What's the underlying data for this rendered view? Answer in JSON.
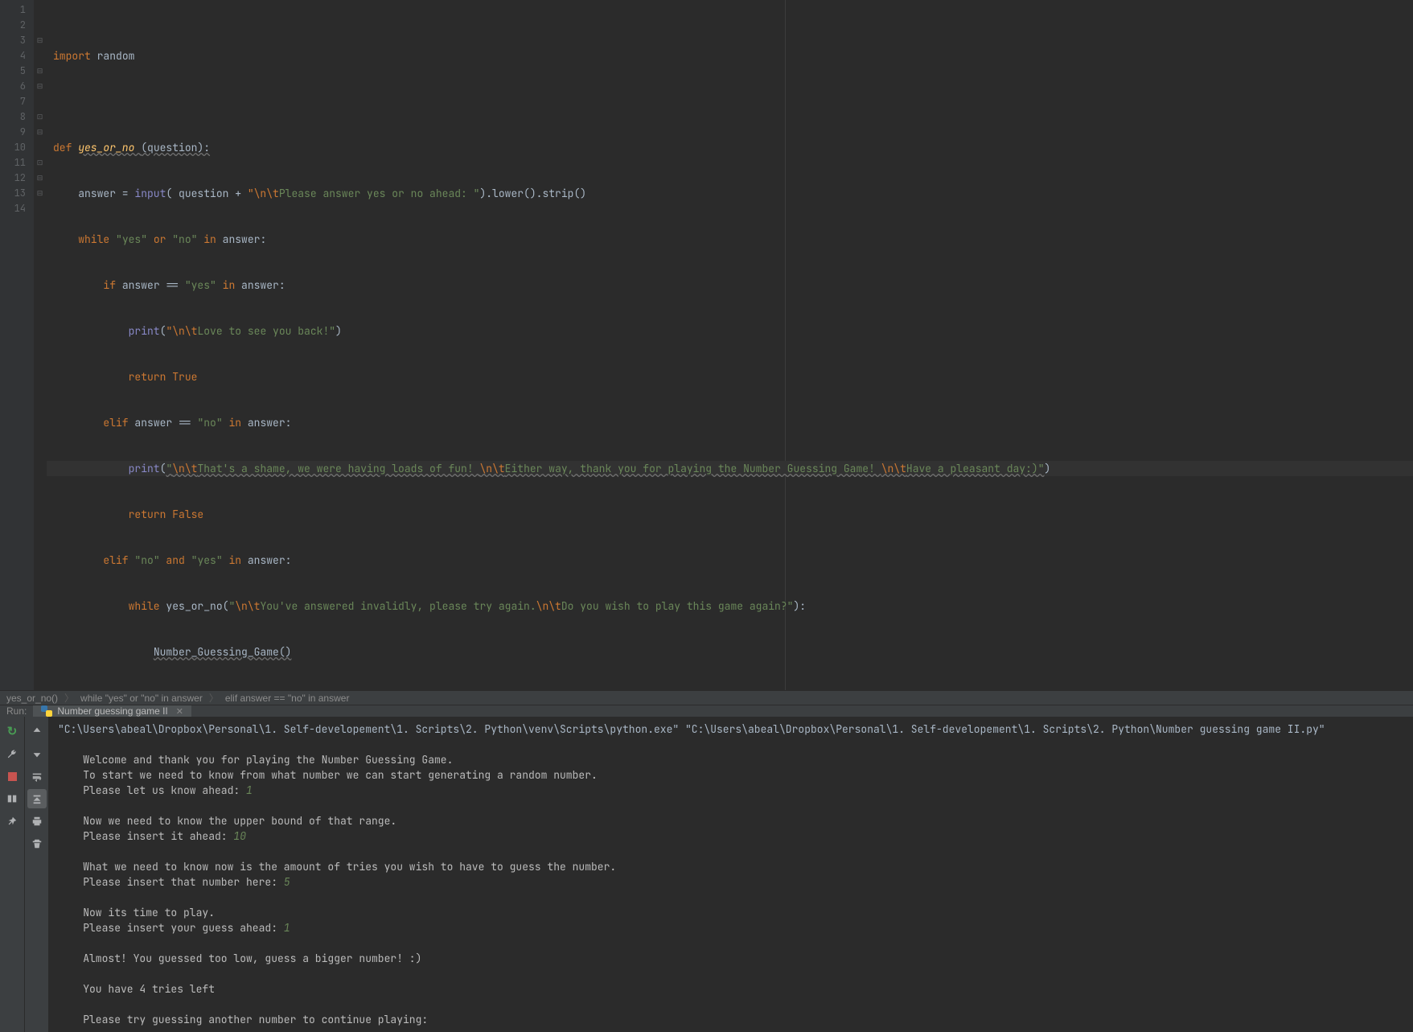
{
  "editor": {
    "lines": [
      "1",
      "2",
      "3",
      "4",
      "5",
      "6",
      "7",
      "8",
      "9",
      "10",
      "11",
      "12",
      "13",
      "14"
    ],
    "highlighted_line": 10,
    "code": {
      "l1": {
        "kw": "import",
        "mod": " random"
      },
      "l3": {
        "kw": "def ",
        "fn": "yes_or_no ",
        "params": "(question):"
      },
      "l4": {
        "indent": "    ",
        "lhs": "answer = ",
        "builtin": "input",
        "open": "( question + ",
        "str1_esc": "\"\\n\\t",
        "str1_body": "Please answer yes or no ahead: \"",
        "tail": ").lower().strip()"
      },
      "l5": {
        "indent": "    ",
        "kw": "while ",
        "s1": "\"yes\"",
        "or": " or ",
        "s2": "\"no\"",
        "in": " in ",
        "rest": "answer:"
      },
      "l6": {
        "indent": "        ",
        "kw": "if ",
        "lhs": "answer == ",
        "s": "\"yes\"",
        "in": " in ",
        "rest": "answer:"
      },
      "l7": {
        "indent": "            ",
        "print": "print",
        "open": "(",
        "esc": "\"\\n\\t",
        "body": "Love to see you back!\"",
        "close": ")"
      },
      "l8": {
        "indent": "            ",
        "kw": "return ",
        "val": "True"
      },
      "l9": {
        "indent": "        ",
        "kw": "elif ",
        "lhs": "answer == ",
        "s": "\"no\"",
        "in": " in ",
        "rest": "answer:"
      },
      "l10": {
        "indent": "            ",
        "print": "print",
        "open": "(",
        "s_open": "\"",
        "e1": "\\n\\t",
        "t1": "That's a shame, we were having loads of fun! ",
        "e2": "\\n\\t",
        "t2": "Either way, thank you for playing the Number Guessing Game! ",
        "e3": "\\n\\t",
        "t3": "Have a pleasant day:)\"",
        "close": ")"
      },
      "l11": {
        "indent": "            ",
        "kw": "return ",
        "val": "False"
      },
      "l12": {
        "indent": "        ",
        "kw": "elif ",
        "s1": "\"no\"",
        "and": " and ",
        "s2": "\"yes\"",
        "in": " in ",
        "rest": "answer:"
      },
      "l13": {
        "indent": "            ",
        "kw": "while ",
        "fn": "yes_or_no",
        "open": "(",
        "s_open": "\"",
        "e1": "\\n\\t",
        "t1": "You've answered invalidly, please try again.",
        "e2": "\\n\\t",
        "t2": "Do you wish to play this game again?\"",
        "close": "):"
      },
      "l14": {
        "indent": "                ",
        "call": "Number_Guessing_Game()"
      }
    }
  },
  "breadcrumb": {
    "items": [
      "yes_or_no()",
      "while \"yes\" or \"no\" in answer",
      "elif answer == \"no\" in answer"
    ]
  },
  "run": {
    "label": "Run:",
    "tab_name": "Number guessing game II"
  },
  "console": {
    "cmd": "\"C:\\Users\\abeal\\Dropbox\\Personal\\1. Self-developement\\1. Scripts\\2. Python\\venv\\Scripts\\python.exe\" \"C:\\Users\\abeal\\Dropbox\\Personal\\1. Self-developement\\1. Scripts\\2. Python\\Number guessing game II.py\"",
    "lines": [
      {
        "t": "",
        "k": "blank"
      },
      {
        "t": "    Welcome and thank you for playing the Number Guessing Game.",
        "k": "out"
      },
      {
        "t": "    To start we need to know from what number we can start generating a random number.",
        "k": "out"
      },
      {
        "t": "    Please let us know ahead: ",
        "k": "out",
        "in": "1"
      },
      {
        "t": "",
        "k": "blank"
      },
      {
        "t": "    Now we need to know the upper bound of that range.",
        "k": "out"
      },
      {
        "t": "    Please insert it ahead: ",
        "k": "out",
        "in": "10"
      },
      {
        "t": "",
        "k": "blank"
      },
      {
        "t": "    What we need to know now is the amount of tries you wish to have to guess the number.",
        "k": "out"
      },
      {
        "t": "    Please insert that number here: ",
        "k": "out",
        "in": "5"
      },
      {
        "t": "",
        "k": "blank"
      },
      {
        "t": "    Now its time to play.",
        "k": "out"
      },
      {
        "t": "    Please insert your guess ahead: ",
        "k": "out",
        "in": "1"
      },
      {
        "t": "",
        "k": "blank"
      },
      {
        "t": "    Almost! You guessed too low, guess a bigger number! :)",
        "k": "out"
      },
      {
        "t": "",
        "k": "blank"
      },
      {
        "t": "    You have 4 tries left",
        "k": "out"
      },
      {
        "t": "",
        "k": "blank"
      },
      {
        "t": "    Please try guessing another number to continue playing: ",
        "k": "out"
      }
    ]
  },
  "icons": {
    "rerun": "rerun-icon",
    "up": "up-icon",
    "down": "down-icon",
    "wrench": "wrench-icon",
    "stop": "stop-icon",
    "layout": "layout-icon",
    "pin": "pin-icon",
    "wrap": "wrap-icon",
    "scroll": "scroll-end-icon",
    "print": "print-icon",
    "trash": "trash-icon"
  }
}
